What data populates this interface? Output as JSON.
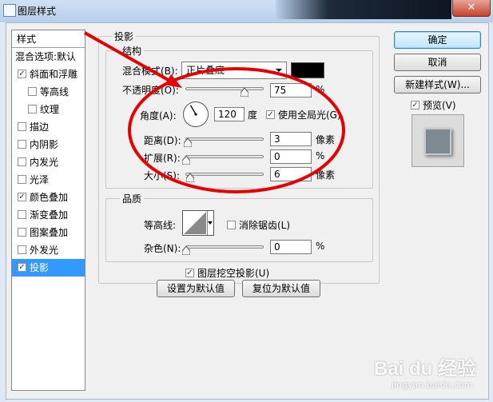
{
  "window": {
    "title": "图层样式",
    "close_glyph": "✕"
  },
  "left_panel": {
    "header": "样式",
    "items": [
      {
        "label": "混合选项:默认",
        "checkbox": false,
        "checked": false,
        "indent": false,
        "selected": false
      },
      {
        "label": "斜面和浮雕",
        "checkbox": true,
        "checked": true,
        "indent": false,
        "selected": false
      },
      {
        "label": "等高线",
        "checkbox": true,
        "checked": false,
        "indent": true,
        "selected": false
      },
      {
        "label": "纹理",
        "checkbox": true,
        "checked": false,
        "indent": true,
        "selected": false
      },
      {
        "label": "描边",
        "checkbox": true,
        "checked": false,
        "indent": false,
        "selected": false
      },
      {
        "label": "内阴影",
        "checkbox": true,
        "checked": false,
        "indent": false,
        "selected": false
      },
      {
        "label": "内发光",
        "checkbox": true,
        "checked": false,
        "indent": false,
        "selected": false
      },
      {
        "label": "光泽",
        "checkbox": true,
        "checked": false,
        "indent": false,
        "selected": false
      },
      {
        "label": "颜色叠加",
        "checkbox": true,
        "checked": true,
        "indent": false,
        "selected": false
      },
      {
        "label": "渐变叠加",
        "checkbox": true,
        "checked": false,
        "indent": false,
        "selected": false
      },
      {
        "label": "图案叠加",
        "checkbox": true,
        "checked": false,
        "indent": false,
        "selected": false
      },
      {
        "label": "外发光",
        "checkbox": true,
        "checked": false,
        "indent": false,
        "selected": false
      },
      {
        "label": "投影",
        "checkbox": true,
        "checked": true,
        "indent": false,
        "selected": true
      }
    ]
  },
  "drop_shadow": {
    "group_title": "投影",
    "structure": {
      "title": "结构",
      "blend_mode_label": "混合模式(B):",
      "blend_mode_value": "正片叠底",
      "shadow_color": "#000000",
      "opacity_label": "不透明度(O):",
      "opacity_value": "75",
      "opacity_unit": "%",
      "opacity_fraction": 0.75,
      "angle_label": "角度(A):",
      "angle_value": "120",
      "angle_unit": "度",
      "angle_degrees": 120,
      "global_light_label": "使用全局光(G)",
      "global_light_checked": true,
      "distance_label": "距离(D):",
      "distance_value": "3",
      "distance_unit": "像素",
      "spread_label": "扩展(R):",
      "spread_value": "0",
      "spread_unit": "%",
      "size_label": "大小(S):",
      "size_value": "6",
      "size_unit": "像素"
    },
    "quality": {
      "title": "品质",
      "contour_label": "等高线:",
      "anti_alias_label": "消除锯齿(L)",
      "anti_alias_checked": false,
      "noise_label": "杂色(N):",
      "noise_value": "0",
      "noise_unit": "%"
    },
    "knockout_label": "图层挖空投影(U)",
    "knockout_checked": true,
    "make_default_label": "设置为默认值",
    "reset_default_label": "复位为默认值"
  },
  "right_panel": {
    "ok_label": "确定",
    "cancel_label": "取消",
    "new_style_label": "新建样式(W)...",
    "preview_label": "预览(V)",
    "preview_checked": true
  },
  "watermark": {
    "brand": "Bai du 经验",
    "url": "jingyan.baidu.com"
  },
  "colors": {
    "selection": "#3399ff",
    "annotation_red": "#e60000"
  },
  "check_glyph": "✓"
}
